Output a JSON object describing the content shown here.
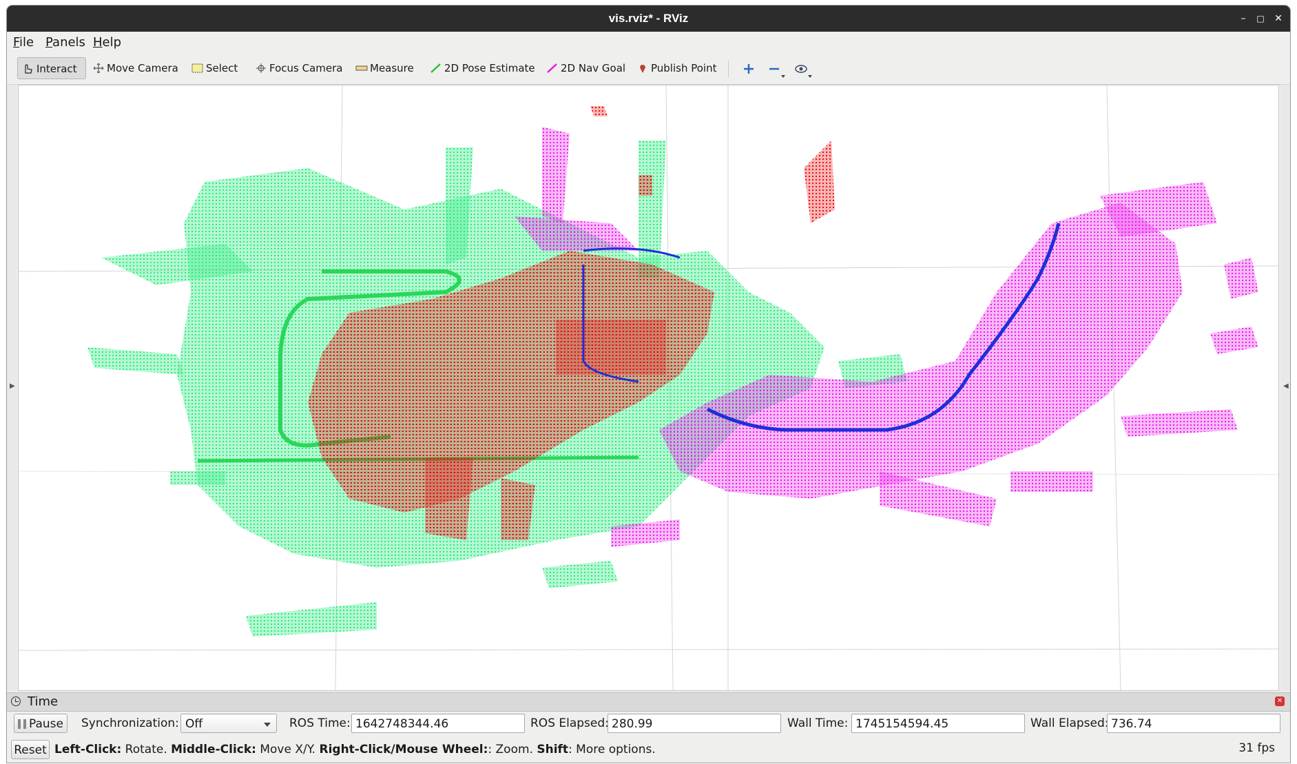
{
  "window": {
    "title": "vis.rviz* - RViz",
    "controls": {
      "minimize": "–",
      "maximize": "□",
      "close": "✕"
    }
  },
  "menubar": {
    "file": {
      "u": "F",
      "rest": "ile"
    },
    "panels": {
      "u": "P",
      "rest": "anels"
    },
    "help": {
      "u": "H",
      "rest": "elp"
    }
  },
  "toolbar": {
    "tools": [
      {
        "label": "Interact",
        "icon": "hand-pointer-icon",
        "active": true
      },
      {
        "label": "Move Camera",
        "icon": "move-arrows-icon"
      },
      {
        "label": "Select",
        "icon": "select-box-icon"
      },
      {
        "label": "Focus Camera",
        "icon": "focus-target-icon"
      },
      {
        "label": "Measure",
        "icon": "ruler-icon"
      },
      {
        "label": "2D Pose Estimate",
        "icon": "green-arrow-icon",
        "color": "#2fbf3a"
      },
      {
        "label": "2D Nav Goal",
        "icon": "magenta-arrow-icon",
        "color": "#e21be2"
      },
      {
        "label": "Publish Point",
        "icon": "map-pin-icon",
        "color": "#c0382b"
      }
    ],
    "extra_icons": [
      "plus-icon",
      "minus-icon",
      "eye-icon"
    ]
  },
  "viewport": {
    "background": "#ffffff",
    "colors": {
      "green_cloud": "#2bea7e",
      "red_cloud": "#ee0a0a",
      "magenta_cloud": "#ee18ee",
      "trajectory": "#1f2fd8",
      "grid": "#d4d4d4"
    }
  },
  "time_panel": {
    "title": "Time",
    "pause_label": "Pause",
    "sync_label": "Synchronization:",
    "sync_value": "Off",
    "ros_time_label": "ROS Time:",
    "ros_time_value": "1642748344.46",
    "ros_elapsed_label": "ROS Elapsed:",
    "ros_elapsed_value": "280.99",
    "wall_time_label": "Wall Time:",
    "wall_time_value": "1745154594.45",
    "wall_elapsed_label": "Wall Elapsed:",
    "wall_elapsed_value": "736.74"
  },
  "status_bar": {
    "reset_label": "Reset",
    "left_click": "Left-Click:",
    "left_action": " Rotate. ",
    "middle_click": "Middle-Click:",
    "middle_action": " Move X/Y. ",
    "right_click": "Right-Click/Mouse Wheel:",
    "right_action": ": Zoom. ",
    "shift": "Shift",
    "shift_action": ": More options.",
    "fps": "31 fps"
  }
}
